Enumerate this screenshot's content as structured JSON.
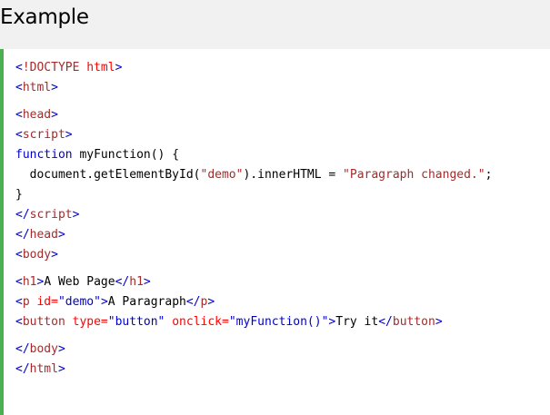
{
  "header": {
    "title": "Example"
  },
  "code": {
    "l1": {
      "open": "<",
      "name": "!DOCTYPE",
      "rest": " html",
      "close": ">"
    },
    "l2": {
      "open": "<",
      "name": "html",
      "close": ">"
    },
    "l3": {
      "open": "<",
      "name": "head",
      "close": ">"
    },
    "l4": {
      "open": "<",
      "name": "script",
      "close": ">"
    },
    "l5": {
      "kw": "function",
      "rest": " myFunction() {"
    },
    "l6": {
      "pre": "  document.getElementById(",
      "s1": "\"demo\"",
      "mid": ").innerHTML = ",
      "s2": "\"Paragraph changed.\"",
      "end": ";"
    },
    "l7": {
      "text": "}"
    },
    "l8": {
      "open": "</",
      "name": "script",
      "close": ">"
    },
    "l9": {
      "open": "</",
      "name": "head",
      "close": ">"
    },
    "l10": {
      "open": "<",
      "name": "body",
      "close": ">"
    },
    "l11": {
      "o1": "<",
      "n1": "h1",
      "c1": ">",
      "text": "A Web Page",
      "o2": "</",
      "n2": "h1",
      "c2": ">"
    },
    "l12": {
      "o1": "<",
      "n1": "p",
      "attr": " id=",
      "val": "\"demo\"",
      "c1": ">",
      "text": "A Paragraph",
      "o2": "</",
      "n2": "p",
      "c2": ">"
    },
    "l13": {
      "o1": "<",
      "n1": "button",
      "a1": " type=",
      "v1": "\"button\"",
      "a2": " onclick=",
      "v2": "\"myFunction()\"",
      "c1": ">",
      "text": "Try it",
      "o2": "</",
      "n2": "button",
      "c2": ">"
    },
    "l14": {
      "open": "</",
      "name": "body",
      "close": ">"
    },
    "l15": {
      "open": "</",
      "name": "html",
      "close": ">"
    }
  },
  "colors": {
    "accent_border": "#4CAF50",
    "tag": "mediumblue",
    "element": "brown",
    "attribute": "red",
    "string": "brown"
  }
}
